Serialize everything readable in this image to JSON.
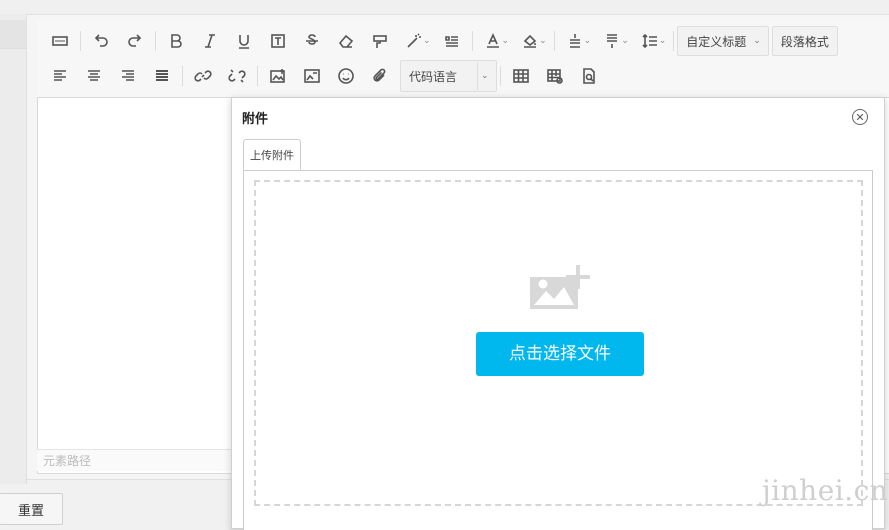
{
  "toolbar": {
    "custom_title_label": "自定义标题",
    "paragraph_format_label": "段落格式",
    "code_language_label": "代码语言"
  },
  "editor": {
    "element_path_label": "元素路径"
  },
  "page": {
    "reset_button_label": "重置"
  },
  "dialog": {
    "title": "附件",
    "tab_label": "上传附件",
    "choose_file_label": "点击选择文件"
  },
  "watermark": "jinhei.cn",
  "colors": {
    "accent": "#00b7ee",
    "border": "#d9d9d9",
    "toolbar_bg": "#f7f7f7"
  }
}
